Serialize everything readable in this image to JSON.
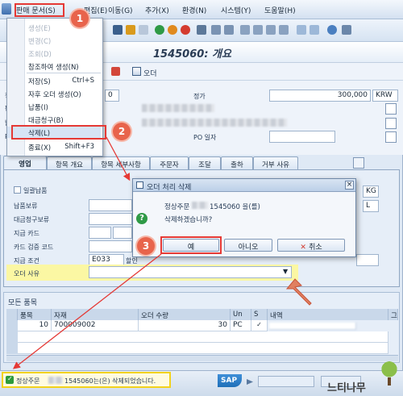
{
  "menubar": {
    "items": [
      "판매 문서(S)",
      "편집(E)",
      "이동(G)",
      "추가(X)",
      "환경(N)",
      "시스템(Y)",
      "도움말(H)"
    ]
  },
  "title": {
    "text": "1545060: 개요"
  },
  "app_toolbar": {
    "order_label": "오더"
  },
  "dropdown": {
    "items": [
      {
        "label": "생성(E)",
        "disabled": true,
        "shortcut": ""
      },
      {
        "label": "변경(C)",
        "disabled": true,
        "shortcut": ""
      },
      {
        "label": "조회(D)",
        "disabled": true,
        "shortcut": ""
      },
      {
        "label": "참조하여 생성(N)",
        "disabled": false,
        "shortcut": ""
      },
      {
        "label": "저장(S)",
        "disabled": false,
        "shortcut": "Ctrl+S"
      },
      {
        "label": "자후 오더 생성(O)",
        "disabled": false,
        "shortcut": ""
      },
      {
        "label": "납품(I)",
        "disabled": false,
        "shortcut": ""
      },
      {
        "label": "대금청구(B)",
        "disabled": false,
        "shortcut": ""
      },
      {
        "label": "삭제(L)",
        "disabled": false,
        "shortcut": ""
      },
      {
        "label": "종료(X)",
        "disabled": false,
        "shortcut": "Shift+F3"
      }
    ]
  },
  "header": {
    "value_label": "정가",
    "value": "300,000",
    "currency": "KRW",
    "po_label": "PO",
    "po_date_label": "PO 일자",
    "field_num": "0"
  },
  "tabs": [
    "영업",
    "항목 개요",
    "항목 세부사항",
    "주문자",
    "조달",
    "출하",
    "거부 사유"
  ],
  "sales_tab": {
    "checkbox_label": "일괄납품",
    "fields": [
      "납품보류",
      "대금청구보류",
      "지급 카드",
      "카드 검증 코드",
      "지급 조건",
      "오더 사유"
    ],
    "payment_terms_value": "E033",
    "payment_terms_text": "할인",
    "right_codes": [
      "KG",
      "L"
    ]
  },
  "dialog": {
    "title": "오더 처리 삭제",
    "message_prefix": "정상주문",
    "message_suffix": "1545060 을(를)",
    "question": "삭제하겠습니까?",
    "yes": "예",
    "no": "아니오",
    "cancel": "취소"
  },
  "items": {
    "section_label": "모든 품목",
    "columns": [
      "품목",
      "자재",
      "오더 수량",
      "Un",
      "S",
      "내역",
      "그"
    ],
    "rows": [
      {
        "item": "10",
        "material": "700009002",
        "qty": "30",
        "unit": "PC",
        "status": "✓"
      }
    ]
  },
  "status": {
    "prefix": "정상주문",
    "suffix": "1545060는(은) 삭제되었습니다.",
    "sap_label": "SAP",
    "watermark": "느티나무"
  },
  "annotations": {
    "steps": [
      "1",
      "2",
      "3"
    ]
  },
  "colors": {
    "accent_red": "#e53935",
    "badge": "#e8644c",
    "highlight_yellow": "#fbf7a3",
    "sap_blue": "#1f6fb8",
    "success_green": "#2e9b3b"
  }
}
